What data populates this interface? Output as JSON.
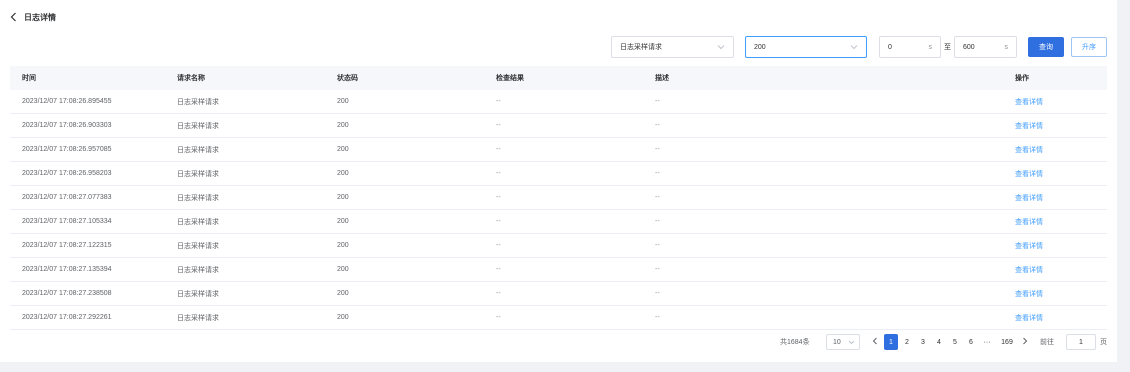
{
  "header": {
    "back_icon": "chevron-left-icon",
    "title": "日志详情"
  },
  "filters": {
    "request_type": "日志采样请求",
    "status_code": "200",
    "min_value": "0",
    "max_value": "600",
    "unit": "s",
    "range_separator": "至",
    "query_label": "查询",
    "sort_label": "升序"
  },
  "table": {
    "columns": [
      "时间",
      "请求名称",
      "状态码",
      "检查结果",
      "描述",
      "操作"
    ],
    "rows": [
      {
        "time": "2023/12/07 17:08:26.895455",
        "name": "日志采样请求",
        "code": "200",
        "check": "--",
        "desc": "--",
        "action": "查看详情"
      },
      {
        "time": "2023/12/07 17:08:26.903303",
        "name": "日志采样请求",
        "code": "200",
        "check": "--",
        "desc": "--",
        "action": "查看详情"
      },
      {
        "time": "2023/12/07 17:08:26.957085",
        "name": "日志采样请求",
        "code": "200",
        "check": "--",
        "desc": "--",
        "action": "查看详情"
      },
      {
        "time": "2023/12/07 17:08:26.958203",
        "name": "日志采样请求",
        "code": "200",
        "check": "--",
        "desc": "--",
        "action": "查看详情"
      },
      {
        "time": "2023/12/07 17:08:27.077383",
        "name": "日志采样请求",
        "code": "200",
        "check": "--",
        "desc": "--",
        "action": "查看详情"
      },
      {
        "time": "2023/12/07 17:08:27.105334",
        "name": "日志采样请求",
        "code": "200",
        "check": "--",
        "desc": "--",
        "action": "查看详情"
      },
      {
        "time": "2023/12/07 17:08:27.122315",
        "name": "日志采样请求",
        "code": "200",
        "check": "--",
        "desc": "--",
        "action": "查看详情"
      },
      {
        "time": "2023/12/07 17:08:27.135394",
        "name": "日志采样请求",
        "code": "200",
        "check": "--",
        "desc": "--",
        "action": "查看详情"
      },
      {
        "time": "2023/12/07 17:08:27.238508",
        "name": "日志采样请求",
        "code": "200",
        "check": "--",
        "desc": "--",
        "action": "查看详情"
      },
      {
        "time": "2023/12/07 17:08:27.292261",
        "name": "日志采样请求",
        "code": "200",
        "check": "--",
        "desc": "--",
        "action": "查看详情"
      }
    ]
  },
  "pagination": {
    "total": "共1684条",
    "page_size": "10",
    "pages": [
      "1",
      "2",
      "3",
      "4",
      "5",
      "6"
    ],
    "current": "1",
    "ellipsis": "···",
    "last_page": "169",
    "goto_label": "前往",
    "goto_value": "1",
    "page_suffix": "页"
  },
  "colors": {
    "primary": "#2f6fe0",
    "link": "#409eff",
    "header_bg": "#f5f7fa"
  }
}
